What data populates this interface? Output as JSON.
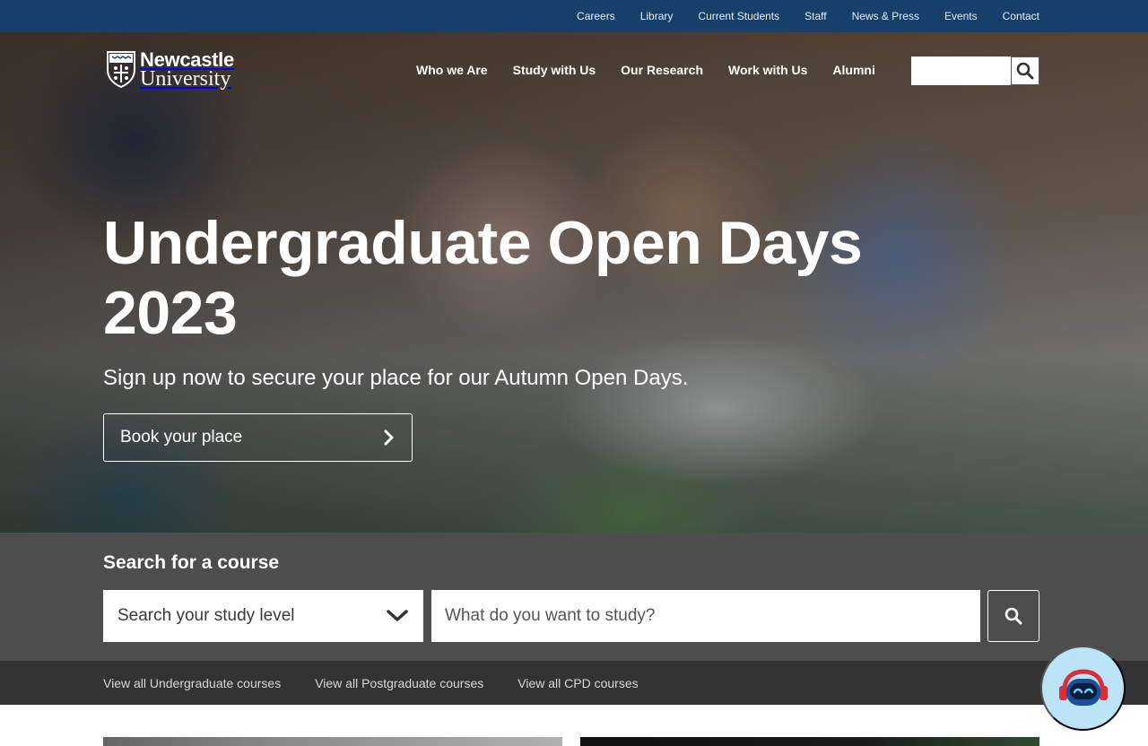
{
  "utility_nav": {
    "items": [
      {
        "label": "Careers"
      },
      {
        "label": "Library"
      },
      {
        "label": "Current Students"
      },
      {
        "label": "Staff"
      },
      {
        "label": "News & Press"
      },
      {
        "label": "Events"
      },
      {
        "label": "Contact"
      }
    ]
  },
  "logo": {
    "line1": "Newcastle",
    "line2": "University",
    "icon": "university-crest-icon"
  },
  "main_nav": {
    "items": [
      {
        "label": "Who we Are"
      },
      {
        "label": "Study with Us"
      },
      {
        "label": "Our Research"
      },
      {
        "label": "Work with Us"
      },
      {
        "label": "Alumni"
      }
    ]
  },
  "site_search": {
    "value": "",
    "placeholder": "",
    "icon": "search-icon"
  },
  "hero": {
    "title": "Undergraduate Open Days 2023",
    "subtitle": "Sign up now to secure your place for our Autumn Open Days.",
    "button_label": "Book your place",
    "button_icon": "chevron-right-icon"
  },
  "course_search": {
    "heading": "Search for a course",
    "level_select": {
      "selected": "Search your study level",
      "icon": "chevron-down-icon"
    },
    "study_input": {
      "value": "",
      "placeholder": "What do you want to study?"
    },
    "button_icon": "search-icon"
  },
  "course_links": {
    "items": [
      {
        "label": "View all Undergraduate courses"
      },
      {
        "label": "View all Postgraduate courses"
      },
      {
        "label": "View all CPD courses"
      }
    ]
  },
  "chatbot": {
    "icon": "chatbot-robot-icon"
  },
  "colors": {
    "utility_bar": "#173f6b",
    "course_search_bg": "#4d4d4d",
    "course_links_bg": "#333333",
    "chatbot_bg": "#bde3f7"
  }
}
